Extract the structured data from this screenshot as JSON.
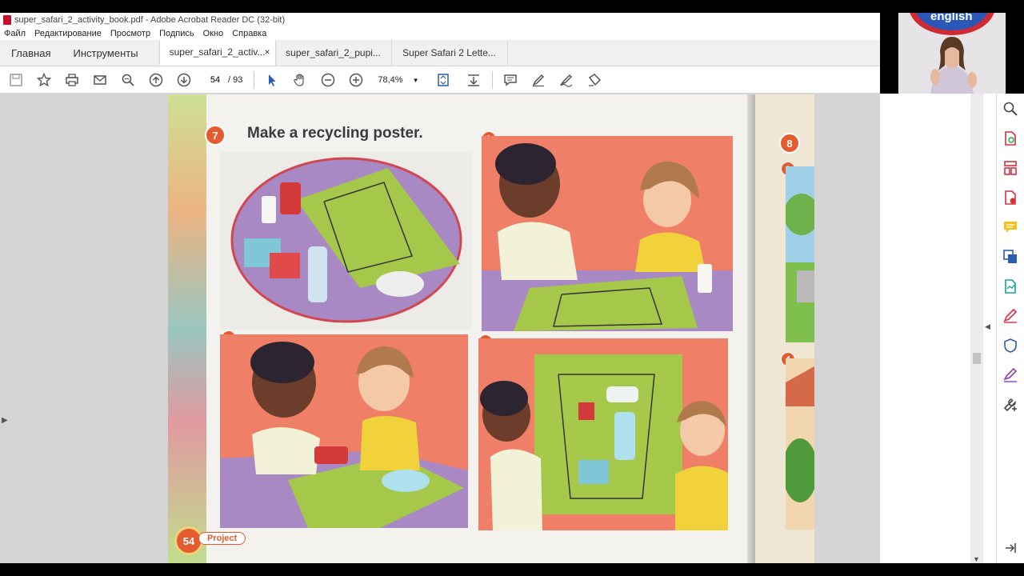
{
  "window": {
    "title": "super_safari_2_activity_book.pdf - Adobe Acrobat Reader DC (32-bit)"
  },
  "menu": [
    "Файл",
    "Редактирование",
    "Просмотр",
    "Подпись",
    "Окно",
    "Справка"
  ],
  "tabs": {
    "home": "Главная",
    "tools": "Инструменты",
    "documents": [
      {
        "label": "super_safari_2_activ...",
        "active": true,
        "close": "×"
      },
      {
        "label": "super_safari_2_pupi...",
        "active": false,
        "close": ""
      },
      {
        "label": "Super Safari 2 Lette...",
        "active": false,
        "close": ""
      }
    ]
  },
  "toolbar": {
    "current_page": "54",
    "total_pages": "/ 93",
    "zoom": "78,4%",
    "icons": [
      "save-icon",
      "star-icon",
      "print-icon",
      "mail-icon",
      "search-icon",
      "page-up-icon",
      "page-down-icon"
    ]
  },
  "book": {
    "activity_number": "7",
    "heading": "Make a recycling poster.",
    "panel_numbers": [
      "1",
      "2",
      "3"
    ],
    "next_activity_number": "8",
    "right_panel_numbers": [
      "1",
      "4"
    ],
    "page_number": "54",
    "page_label": "Project"
  },
  "webcam": {
    "overlay_text": "english"
  },
  "colors": {
    "accent": "#e35b2e",
    "panel_red": "#ef7f66",
    "panel_green": "#a6c84a",
    "panel_purple": "#a889c4"
  }
}
